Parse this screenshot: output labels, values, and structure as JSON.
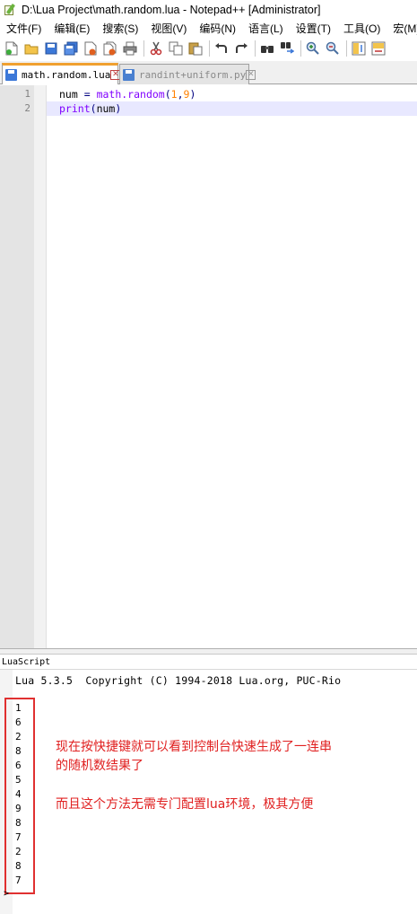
{
  "window": {
    "title": "D:\\Lua Project\\math.random.lua - Notepad++ [Administrator]"
  },
  "menu": [
    "文件(F)",
    "编辑(E)",
    "搜索(S)",
    "视图(V)",
    "编码(N)",
    "语言(L)",
    "设置(T)",
    "工具(O)",
    "宏(M)"
  ],
  "toolbar": {
    "icons": [
      "new-file-icon",
      "open-file-icon",
      "save-icon",
      "save-all-icon",
      "close-icon",
      "close-all-icon",
      "print-icon",
      "cut-icon",
      "copy-icon",
      "paste-icon",
      "undo-icon",
      "redo-icon",
      "find-icon",
      "replace-icon",
      "zoom-in-icon",
      "zoom-out-icon",
      "sync-vertical-icon",
      "sync-horizontal-icon"
    ]
  },
  "tabs": [
    {
      "label": "math.random.lua",
      "active": true
    },
    {
      "label": "randint+uniform.py",
      "active": false
    }
  ],
  "editor": {
    "line_numbers": [
      "1",
      "2"
    ],
    "line1": {
      "id": "num",
      "op": " = ",
      "fn": "math.random",
      "open": "(",
      "a": "1",
      "comma": ",",
      "b": "9",
      "close": ")"
    },
    "line2": {
      "fn": "print",
      "open": "(",
      "arg": "num",
      "close": ")"
    }
  },
  "console": {
    "title": "LuaScript",
    "banner": "Lua 5.3.5  Copyright (C) 1994-2018 Lua.org, PUC-Rio",
    "output": [
      "1",
      "6",
      "2",
      "8",
      "6",
      "5",
      "4",
      "9",
      "8",
      "7",
      "2",
      "8",
      "7"
    ],
    "prompt": ">"
  },
  "annotation": {
    "line1": "现在按快捷键就可以看到控制台快速生成了一连串",
    "line2": "的随机数结果了",
    "line3": "而且这个方法无需专门配置lua环境，极其方便",
    "color": "#e02020"
  },
  "colors": {
    "keyword": "#8000ff",
    "number": "#ff8000",
    "current_line": "#e8e8ff",
    "active_tab_accent": "#f0a030"
  }
}
